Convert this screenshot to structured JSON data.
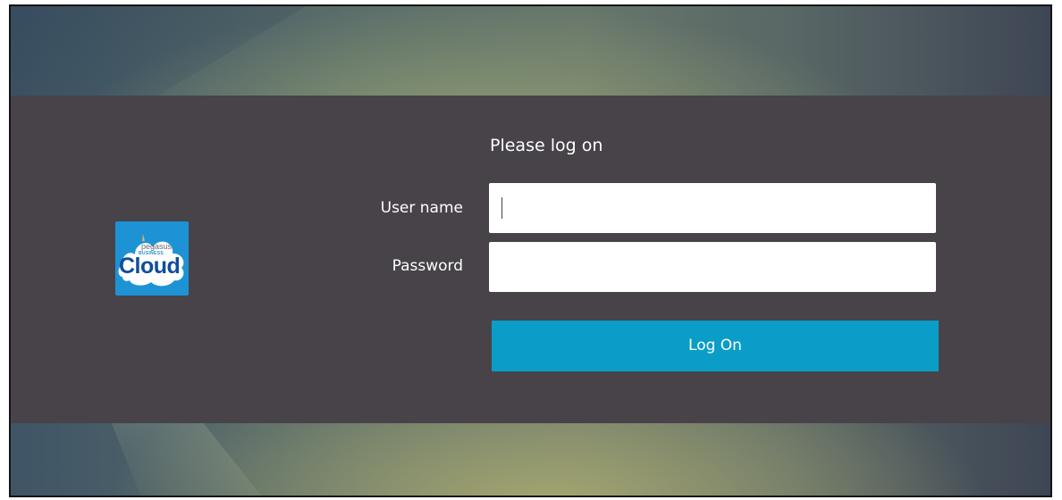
{
  "logo": {
    "brand_small": "pegasus",
    "brand_tiny": "BUSINESS",
    "brand_big": "Cloud"
  },
  "form": {
    "title": "Please log on",
    "username_label": "User name",
    "username_value": "",
    "password_label": "Password",
    "password_value": "",
    "submit_label": "Log On"
  },
  "colors": {
    "band": "#474349",
    "button": "#0a9dc7",
    "logo_bg": "#1d93d6"
  }
}
